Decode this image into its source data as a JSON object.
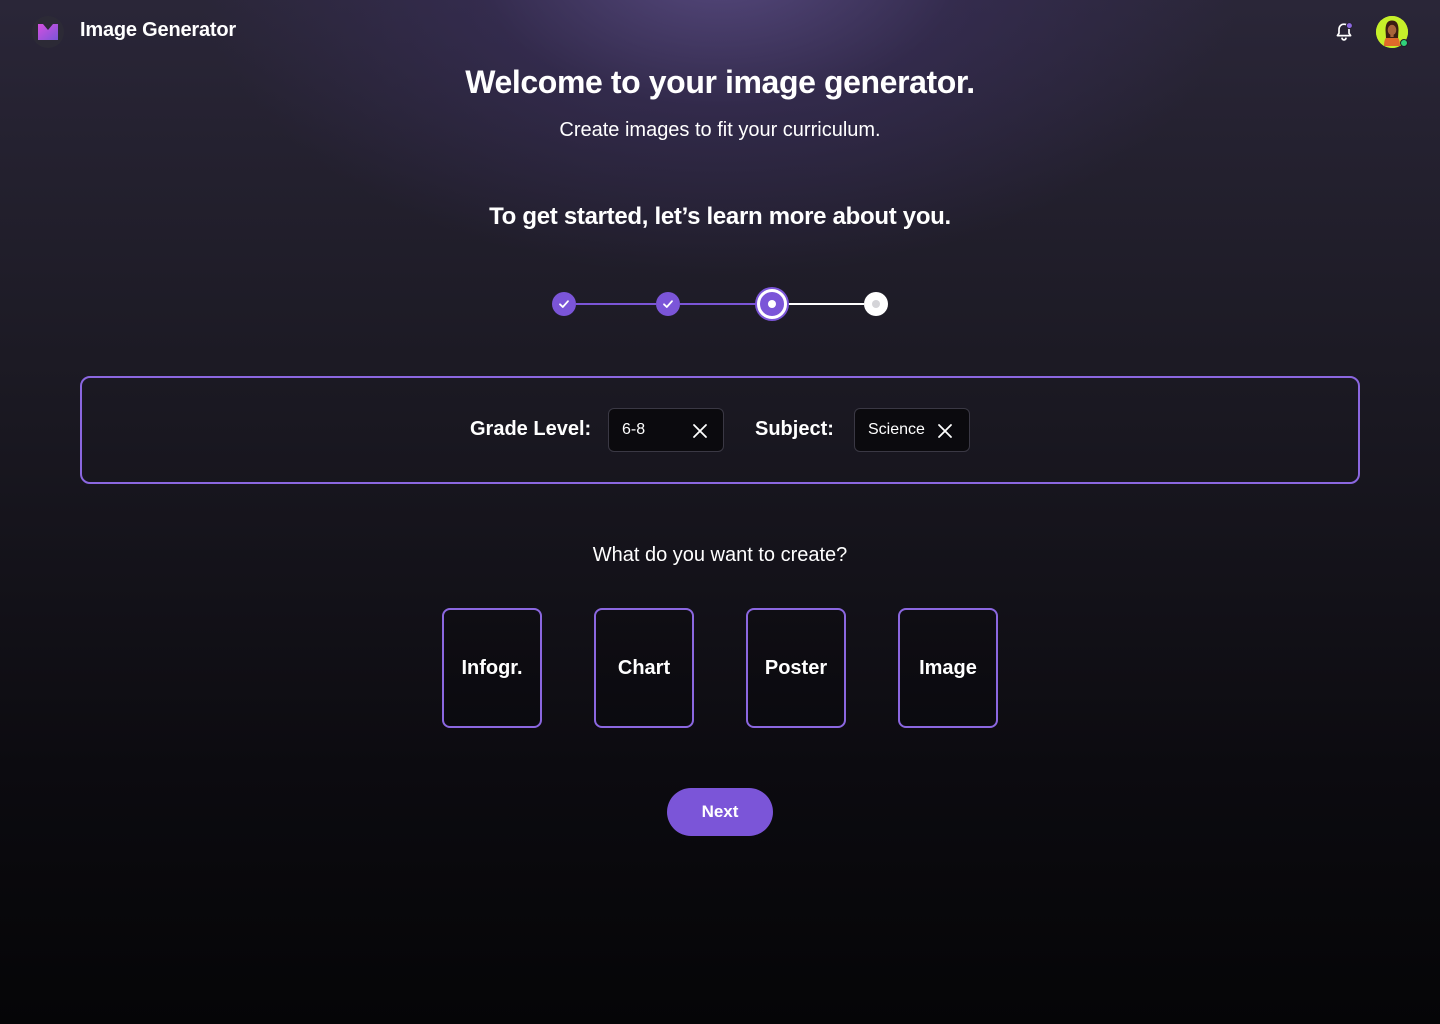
{
  "header": {
    "app_title": "Image Generator",
    "logo_icon": "m-logo-icon",
    "notification_icon": "bell-icon",
    "avatar_icon": "user-avatar"
  },
  "colors": {
    "accent": "#7b55d8",
    "border_accent": "#8b67e0",
    "logo_gradient": [
      "#c54bdc",
      "#7b55d8"
    ]
  },
  "hero": {
    "title": "Welcome to your image generator.",
    "subtitle": "Create images to fit your curriculum."
  },
  "onboarding": {
    "heading": "To get started, let’s learn more about you.",
    "steps": [
      {
        "state": "completed"
      },
      {
        "state": "completed"
      },
      {
        "state": "current"
      },
      {
        "state": "upcoming"
      }
    ]
  },
  "filters": {
    "grade_label": "Grade Level:",
    "grade_value": "6-8",
    "subject_label": "Subject:",
    "subject_value": "Science"
  },
  "create": {
    "question": "What do you want to create?",
    "options": [
      "Infogr.",
      "Chart",
      "Poster",
      "Image"
    ]
  },
  "actions": {
    "next_label": "Next"
  }
}
